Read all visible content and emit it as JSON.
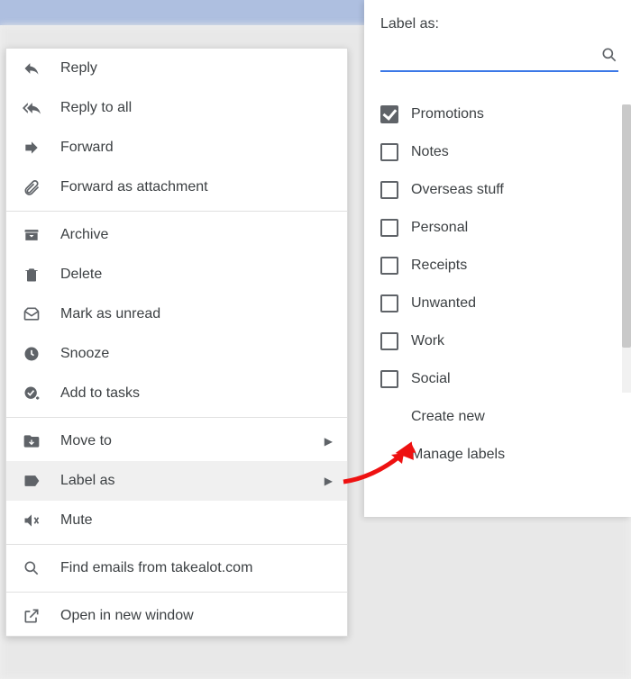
{
  "contextMenu": {
    "reply": "Reply",
    "replyAll": "Reply to all",
    "forward": "Forward",
    "forwardAttachment": "Forward as attachment",
    "archive": "Archive",
    "delete": "Delete",
    "markUnread": "Mark as unread",
    "snooze": "Snooze",
    "addToTasks": "Add to tasks",
    "moveTo": "Move to",
    "labelAs": "Label as",
    "mute": "Mute",
    "findEmails": "Find emails from takealot.com",
    "openNewWindow": "Open in new window"
  },
  "labelPanel": {
    "header": "Label as:",
    "searchPlaceholder": "",
    "labels": [
      {
        "name": "Promotions",
        "checked": true
      },
      {
        "name": "Notes",
        "checked": false
      },
      {
        "name": "Overseas stuff",
        "checked": false
      },
      {
        "name": "Personal",
        "checked": false
      },
      {
        "name": "Receipts",
        "checked": false
      },
      {
        "name": "Unwanted",
        "checked": false
      },
      {
        "name": "Work",
        "checked": false
      },
      {
        "name": "Social",
        "checked": false
      }
    ],
    "createNew": "Create new",
    "manageLabels": "Manage labels"
  }
}
